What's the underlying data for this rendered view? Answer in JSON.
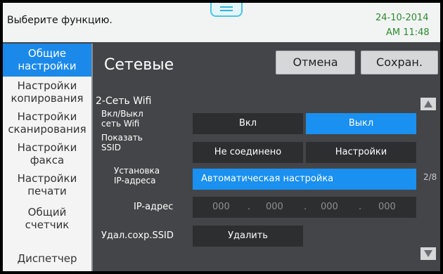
{
  "topbar": {
    "message": "Выберите функцию.",
    "date": "24-10-2014",
    "time": "AM 11:48"
  },
  "menu": {
    "items": [
      {
        "line1": "Общие",
        "line2": "настройки",
        "selected": true
      },
      {
        "line1": "Настройки",
        "line2": "копирования"
      },
      {
        "line1": "Настройки",
        "line2": "сканирования"
      },
      {
        "line1": "Настройки",
        "line2": "факса"
      },
      {
        "line1": "Настройки",
        "line2": "печати"
      },
      {
        "line1": "Общий",
        "line2": "счетчик"
      },
      {
        "line1": "Диспетчер"
      }
    ]
  },
  "main": {
    "heading": "Сетевые",
    "cancel_label": "Отмена",
    "save_label": "Сохран.",
    "section_title": "2-Сеть Wifi",
    "wifi_label_1": "Вкл/Выкл",
    "wifi_label_2": "сеть Wifi",
    "wifi_on": "Вкл",
    "wifi_off": "Выкл",
    "ssid_label_1": "Показать",
    "ssid_label_2": "SSID",
    "ssid_status": "Не соединено",
    "ssid_settings": "Настройки",
    "ip_setup_label_1": "Установка",
    "ip_setup_label_2": "IP-адреса",
    "ip_setup_value": "Автоматическая настройка",
    "ip_label": "IP-адрес",
    "ip_octets": [
      "000",
      "000",
      "000",
      "000"
    ],
    "ip_dot": ".",
    "del_label": "Удал.сохр.SSID",
    "del_button": "Удалить",
    "page_indicator": "2/8"
  },
  "colors": {
    "accent": "#1a90f0",
    "panel": "#434548",
    "field": "#2d2e30",
    "time_text": "#2d8a2d"
  }
}
